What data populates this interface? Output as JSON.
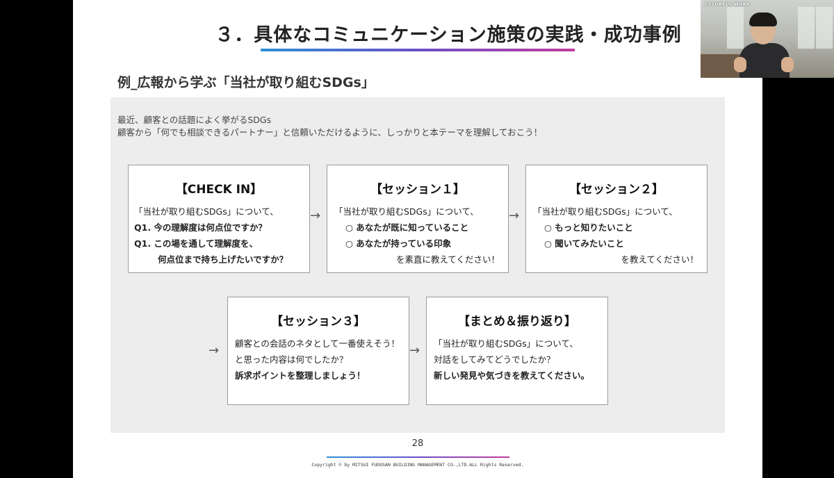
{
  "slide": {
    "title": "３．具体なコミュニケーション施策の実践・成功事例",
    "subtitle": "例_広報から学ぶ「当社が取り組むSDGs」",
    "intro": [
      "最近、顧客との話題によく挙がるSDGs",
      "顧客から「何でも相談できるパートナー」と信頼いただけるように、しっかりと本テーマを理解しておこう！"
    ],
    "arrow": "→",
    "boxes": {
      "checkin": {
        "title": "【CHECK IN】",
        "lines": [
          "「当社が取り組むSDGs」について、",
          "Q1. 今の理解度は何点位ですか？",
          "Q1. この場を通して理解度を、",
          "何点位まで持ち上げたいですか？"
        ]
      },
      "session1": {
        "title": "【セッション１】",
        "lines": [
          "「当社が取り組むSDGs」について、",
          "○ あなたが既に知っていること",
          "○ あなたが持っている印象",
          "を素直に教えてください！"
        ]
      },
      "session2": {
        "title": "【セッション２】",
        "lines": [
          "「当社が取り組むSDGs」について、",
          "○ もっと知りたいこと",
          "○ 聞いてみたいこと",
          "を教えてください！"
        ]
      },
      "session3": {
        "title": "【セッション３】",
        "lines": [
          "顧客との会話のネタとして一番使えそう！",
          "と思った内容は何でしたか？",
          "訴求ポイントを整理しましょう！"
        ]
      },
      "summary": {
        "title": "【まとめ＆振り返り】",
        "lines": [
          "「当社が取り組むSDGs」について、",
          "対話をしてみてどうでしたか？",
          "新しい発見や気づきを教えてください。"
        ]
      }
    },
    "page_number": "28",
    "copyright": "Copyright © by MITSUI FUDOSAN BUILDING MANAGEMENT CO.,LTD.ALL Rights Reserved."
  },
  "webcam": {
    "brand": "COLORFUL WORK"
  }
}
